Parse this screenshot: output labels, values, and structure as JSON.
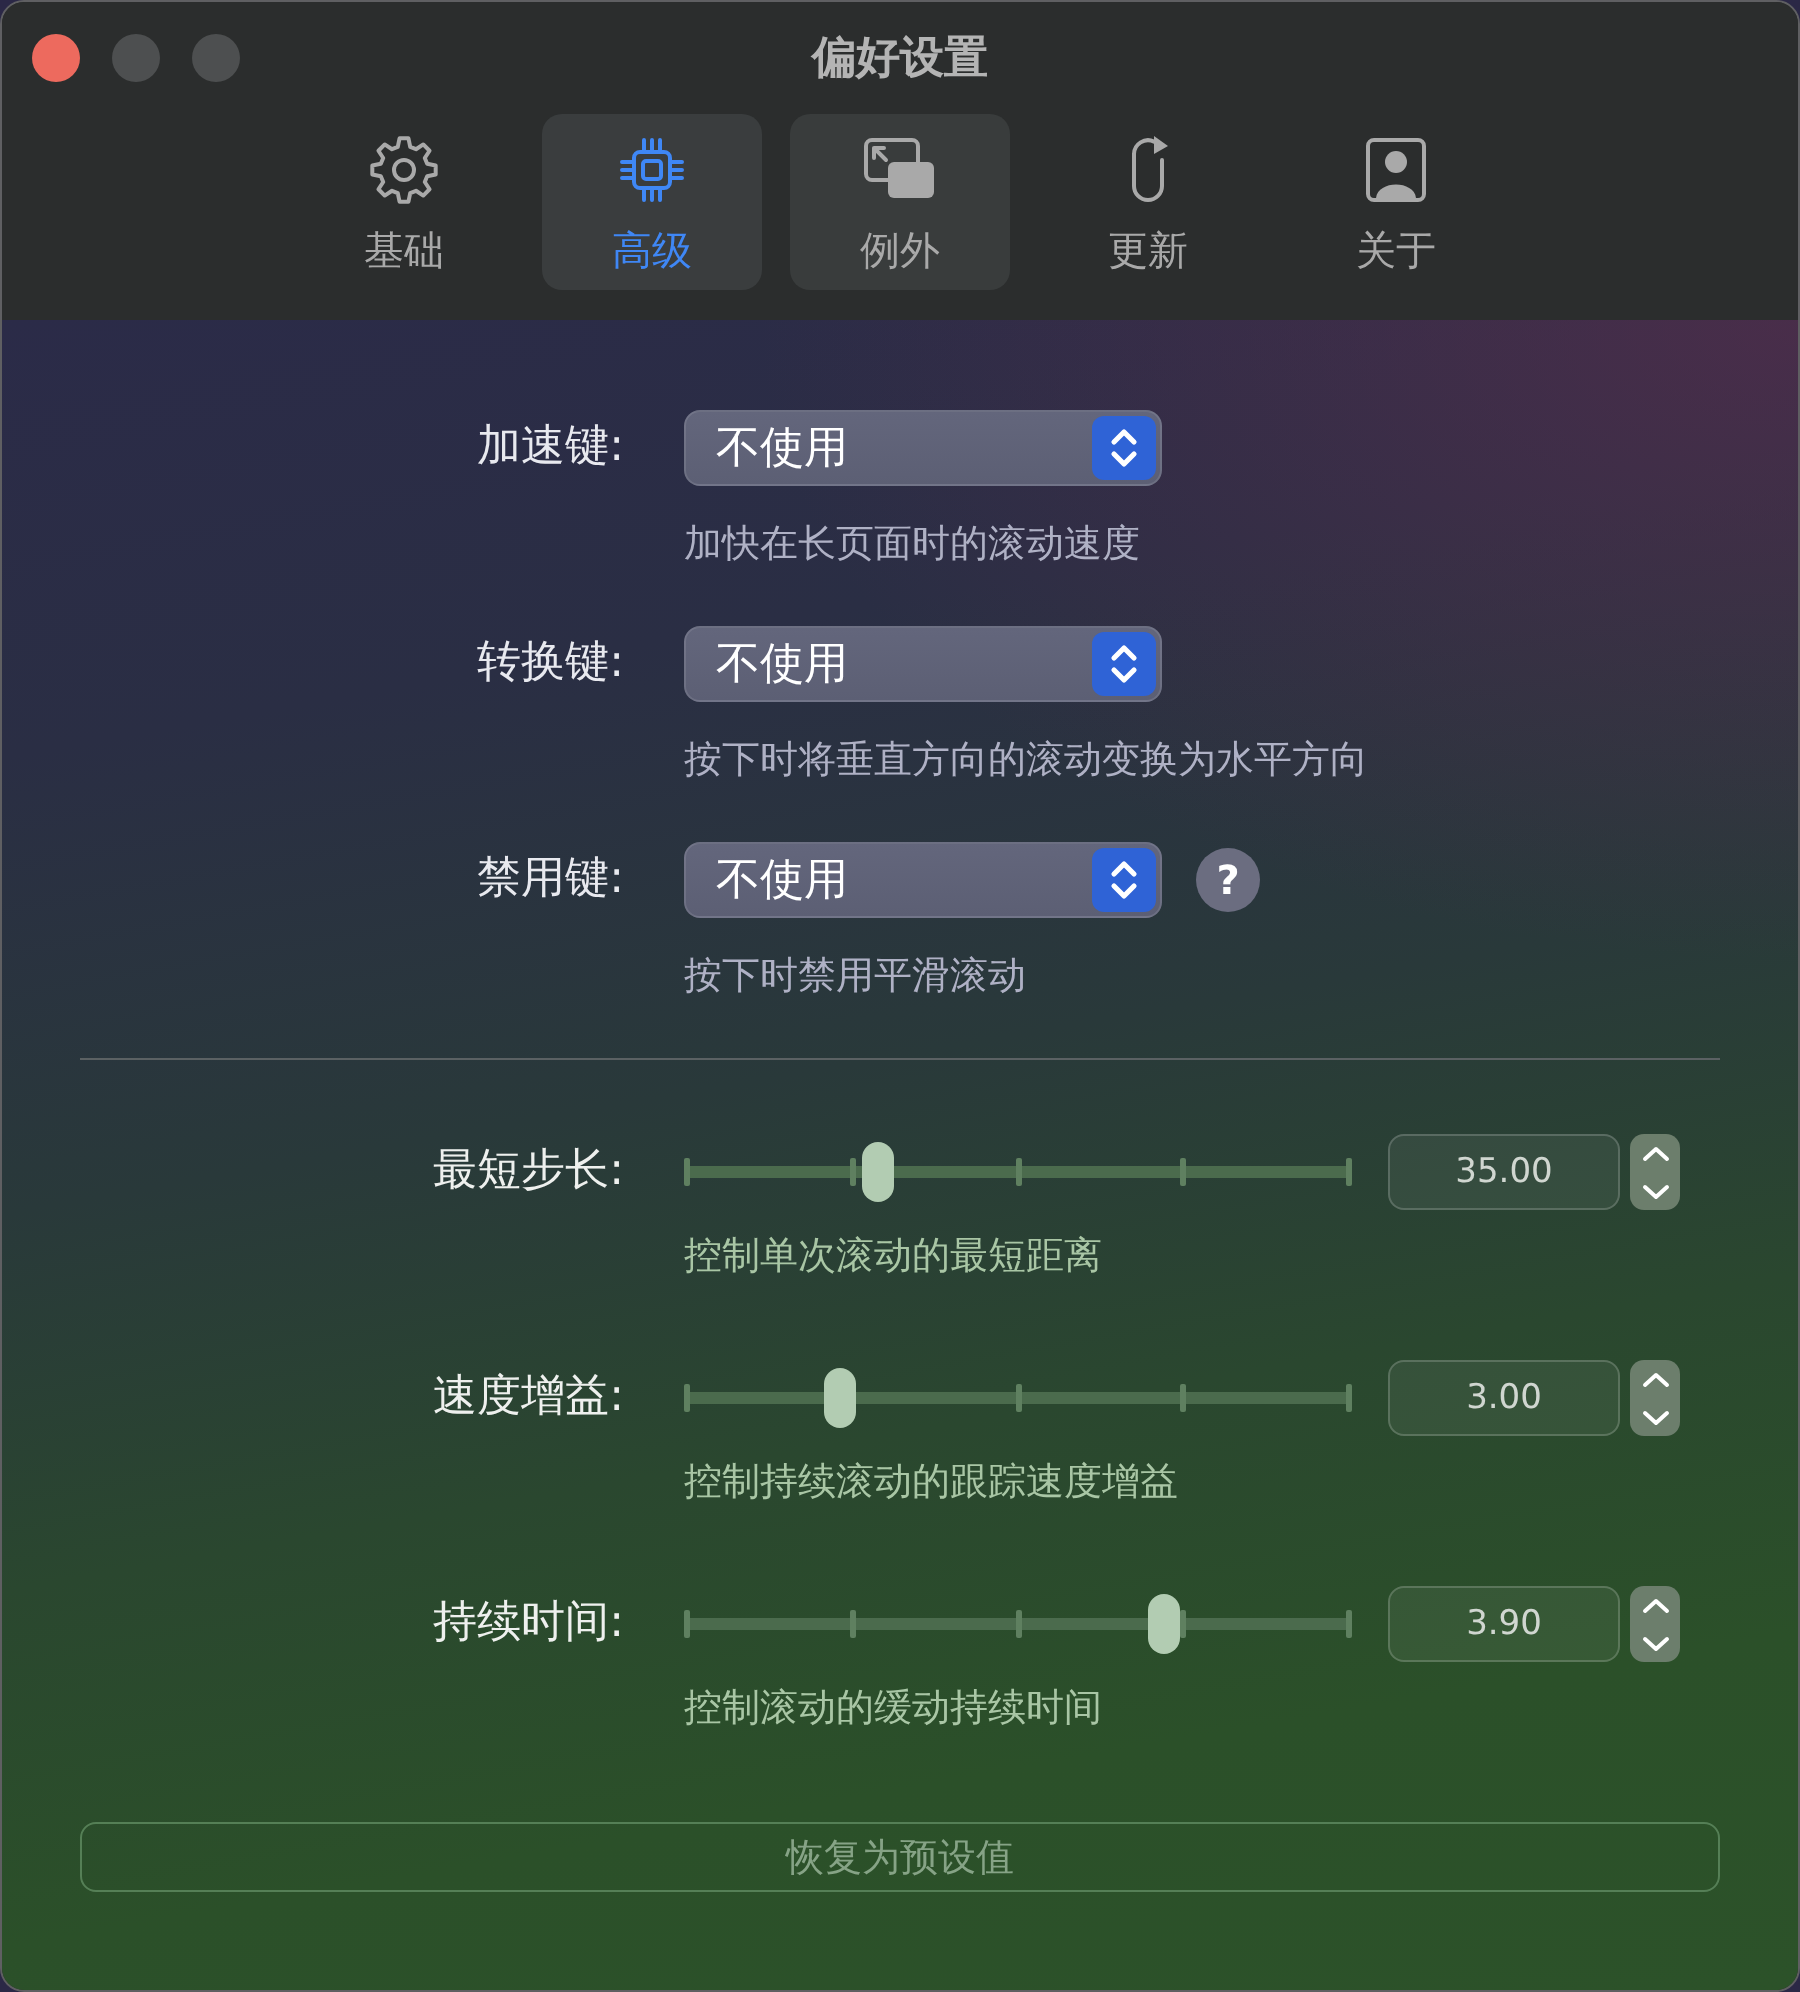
{
  "window": {
    "title": "偏好设置",
    "buttons": [
      {
        "kind": "close",
        "disabled": false
      },
      {
        "kind": "minimize",
        "disabled": true
      },
      {
        "kind": "zoom",
        "disabled": true
      }
    ]
  },
  "tabs": [
    {
      "label": "基础",
      "selected": false,
      "hovered": false
    },
    {
      "label": "高级",
      "selected": true,
      "hovered": false
    },
    {
      "label": "例外",
      "selected": false,
      "hovered": true
    },
    {
      "label": "更新",
      "selected": false,
      "hovered": false
    },
    {
      "label": "关于",
      "selected": false,
      "hovered": false
    }
  ],
  "key_settings": [
    {
      "label": "加速键:",
      "value": "不使用",
      "description": "加快在长页面时的滚动速度"
    },
    {
      "label": "转换键:",
      "value": "不使用",
      "description": "按下时将垂直方向的滚动变换为水平方向"
    },
    {
      "label": "禁用键:",
      "value": "不使用",
      "help": "?",
      "description": "按下时禁用平滑滚动"
    }
  ],
  "slider_settings": [
    {
      "label": "最短步长:",
      "level": 0.28,
      "value": "35.00",
      "description": "控制单次滚动的最短距离"
    },
    {
      "label": "速度增益:",
      "level": 0.22,
      "value": "3.00",
      "description": "控制持续滚动的跟踪速度增益"
    },
    {
      "label": "持续时间:",
      "level": 0.73,
      "value": "3.90",
      "description": "控制滚动的缓动持续时间"
    }
  ],
  "reset_button": {
    "label": "恢复为预设值",
    "disabled": true
  }
}
